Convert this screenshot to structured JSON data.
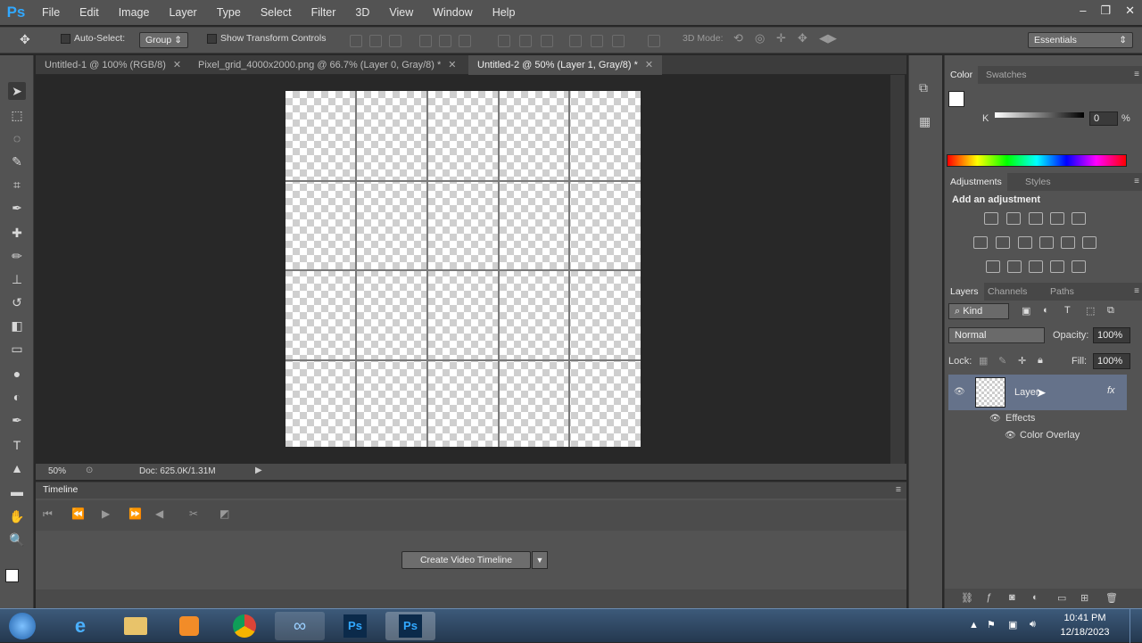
{
  "app": {
    "logo": "Ps"
  },
  "menu": [
    "File",
    "Edit",
    "Image",
    "Layer",
    "Type",
    "Select",
    "Filter",
    "3D",
    "View",
    "Window",
    "Help"
  ],
  "window_controls": {
    "minimize": "–",
    "restore": "❐",
    "close": "✕"
  },
  "options": {
    "auto_select_label": "Auto-Select:",
    "auto_select_value": "Group",
    "show_transform_label": "Show Transform Controls",
    "mode_3d_label": "3D Mode:",
    "workspace": "Essentials"
  },
  "tabs": [
    {
      "label": "Untitled-1 @ 100% (RGB/8)"
    },
    {
      "label": "Pixel_grid_4000x2000.png @ 66.7% (Layer 0, Gray/8) *"
    },
    {
      "label": "Untitled-2 @ 50% (Layer 1, Gray/8) *"
    }
  ],
  "status": {
    "zoom": "50%",
    "doc": "Doc: 625.0K/1.31M"
  },
  "timeline": {
    "title": "Timeline",
    "create_button": "Create Video Timeline"
  },
  "color_panel": {
    "tabs": [
      "Color",
      "Swatches"
    ],
    "channel": "K",
    "value": "0",
    "unit": "%"
  },
  "adjustments_panel": {
    "tabs": [
      "Adjustments",
      "Styles"
    ],
    "heading": "Add an adjustment"
  },
  "layers_panel": {
    "tabs": [
      "Layers",
      "Channels",
      "Paths"
    ],
    "filter_kind": "Kind",
    "blend_mode": "Normal",
    "opacity_label": "Opacity:",
    "opacity": "100%",
    "lock_label": "Lock:",
    "fill_label": "Fill:",
    "fill": "100%",
    "layer_name": "Layer",
    "fx": "fx",
    "effects_label": "Effects",
    "effect_item": "Color Overlay"
  },
  "taskbar": {
    "time": "10:41 PM",
    "date": "12/18/2023"
  }
}
